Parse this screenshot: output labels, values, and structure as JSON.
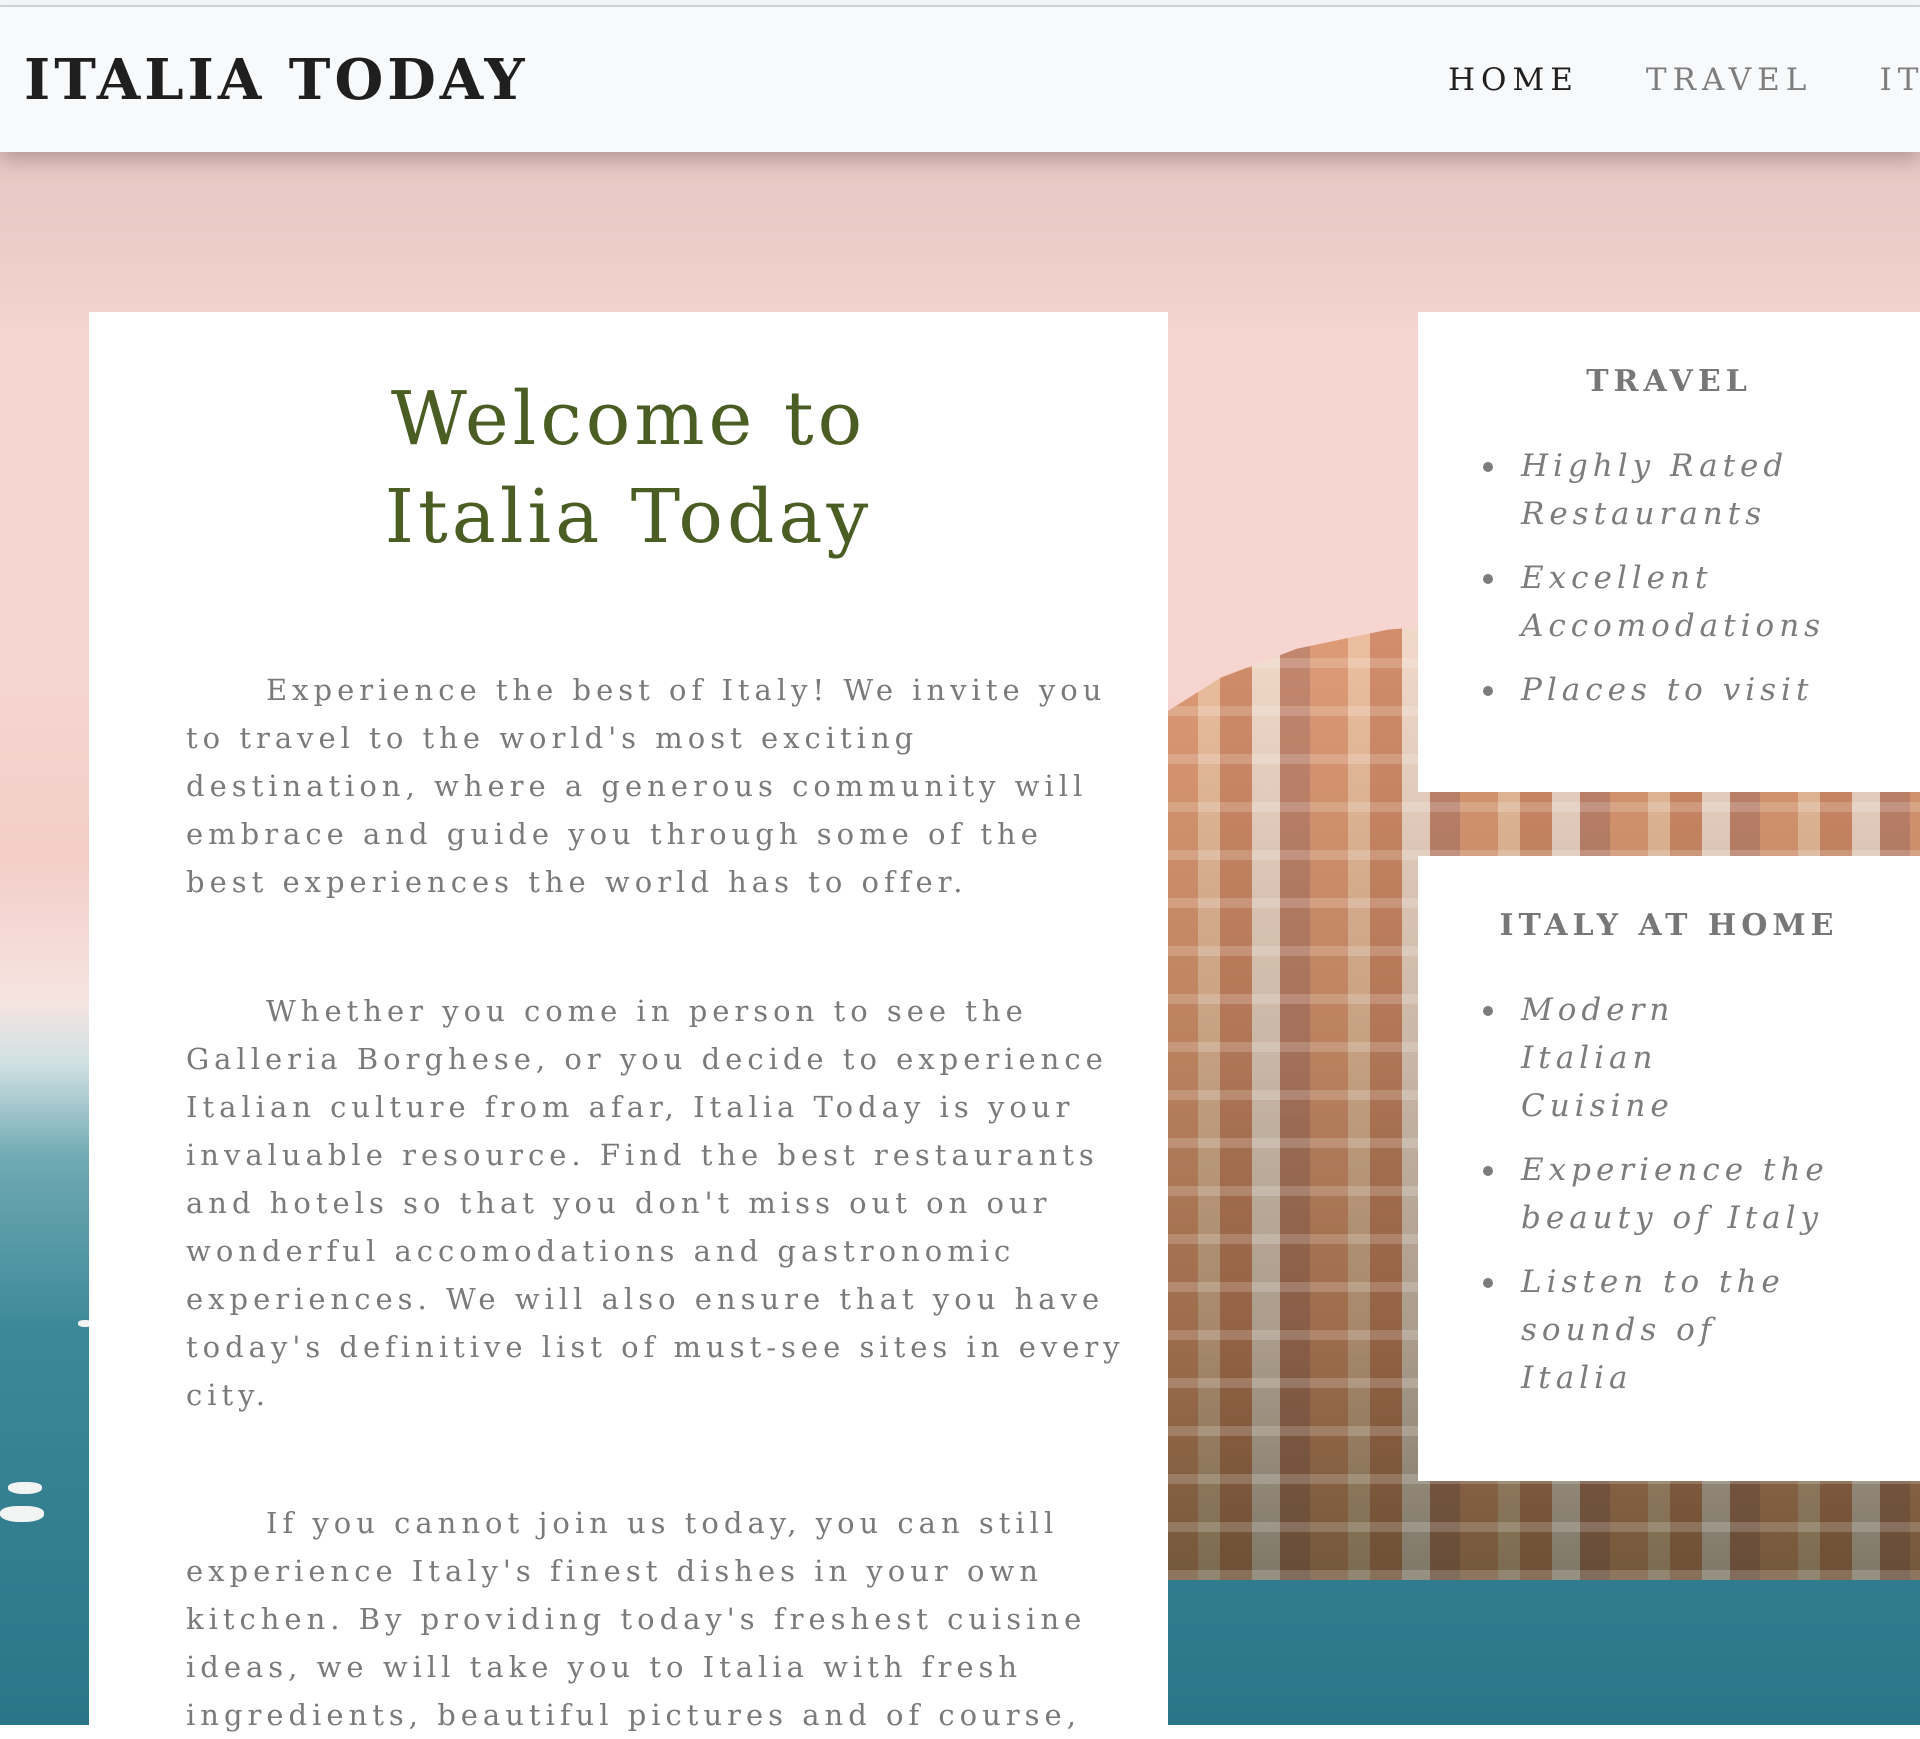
{
  "nav": {
    "brand": "ITALIA TODAY",
    "links": [
      "HOME",
      "TRAVEL",
      "IT"
    ]
  },
  "main": {
    "title_line1": "Welcome to",
    "title_line2": "Italia Today",
    "paragraphs": [
      "Experience the best of Italy! We invite you to travel to the world's most exciting destination, where a generous community will embrace and guide you through some of the best experiences the world has to offer.",
      "Whether you come in person to see the Galleria Borghese, or you decide to experience Italian culture from afar, Italia Today is your invaluable resource. Find the best restaurants and hotels so that you don't miss out on our wonderful accomodations and gastronomic experiences. We will also ensure that you have today's definitive list of must-see sites in every city.",
      "If you cannot join us today, you can still experience Italy's finest dishes in your own kitchen. By providing today's freshest cuisine ideas, we will take you to Italia with fresh ingredients, beautiful pictures and of course,"
    ]
  },
  "sidebar": {
    "travel": {
      "title": "TRAVEL",
      "items": [
        "Highly Rated Restaurants",
        "Excellent Accomodations",
        "Places to visit"
      ]
    },
    "italy_at_home": {
      "title": "ITALY AT HOME",
      "items": [
        "Modern Italian Cuisine",
        "Experience the beauty of Italy",
        "Listen to the sounds of Italia"
      ]
    }
  },
  "colors": {
    "heading_green": "#4a5d23",
    "text_gray": "#7a7a7a",
    "navbar_bg": "#f8f9fb"
  }
}
